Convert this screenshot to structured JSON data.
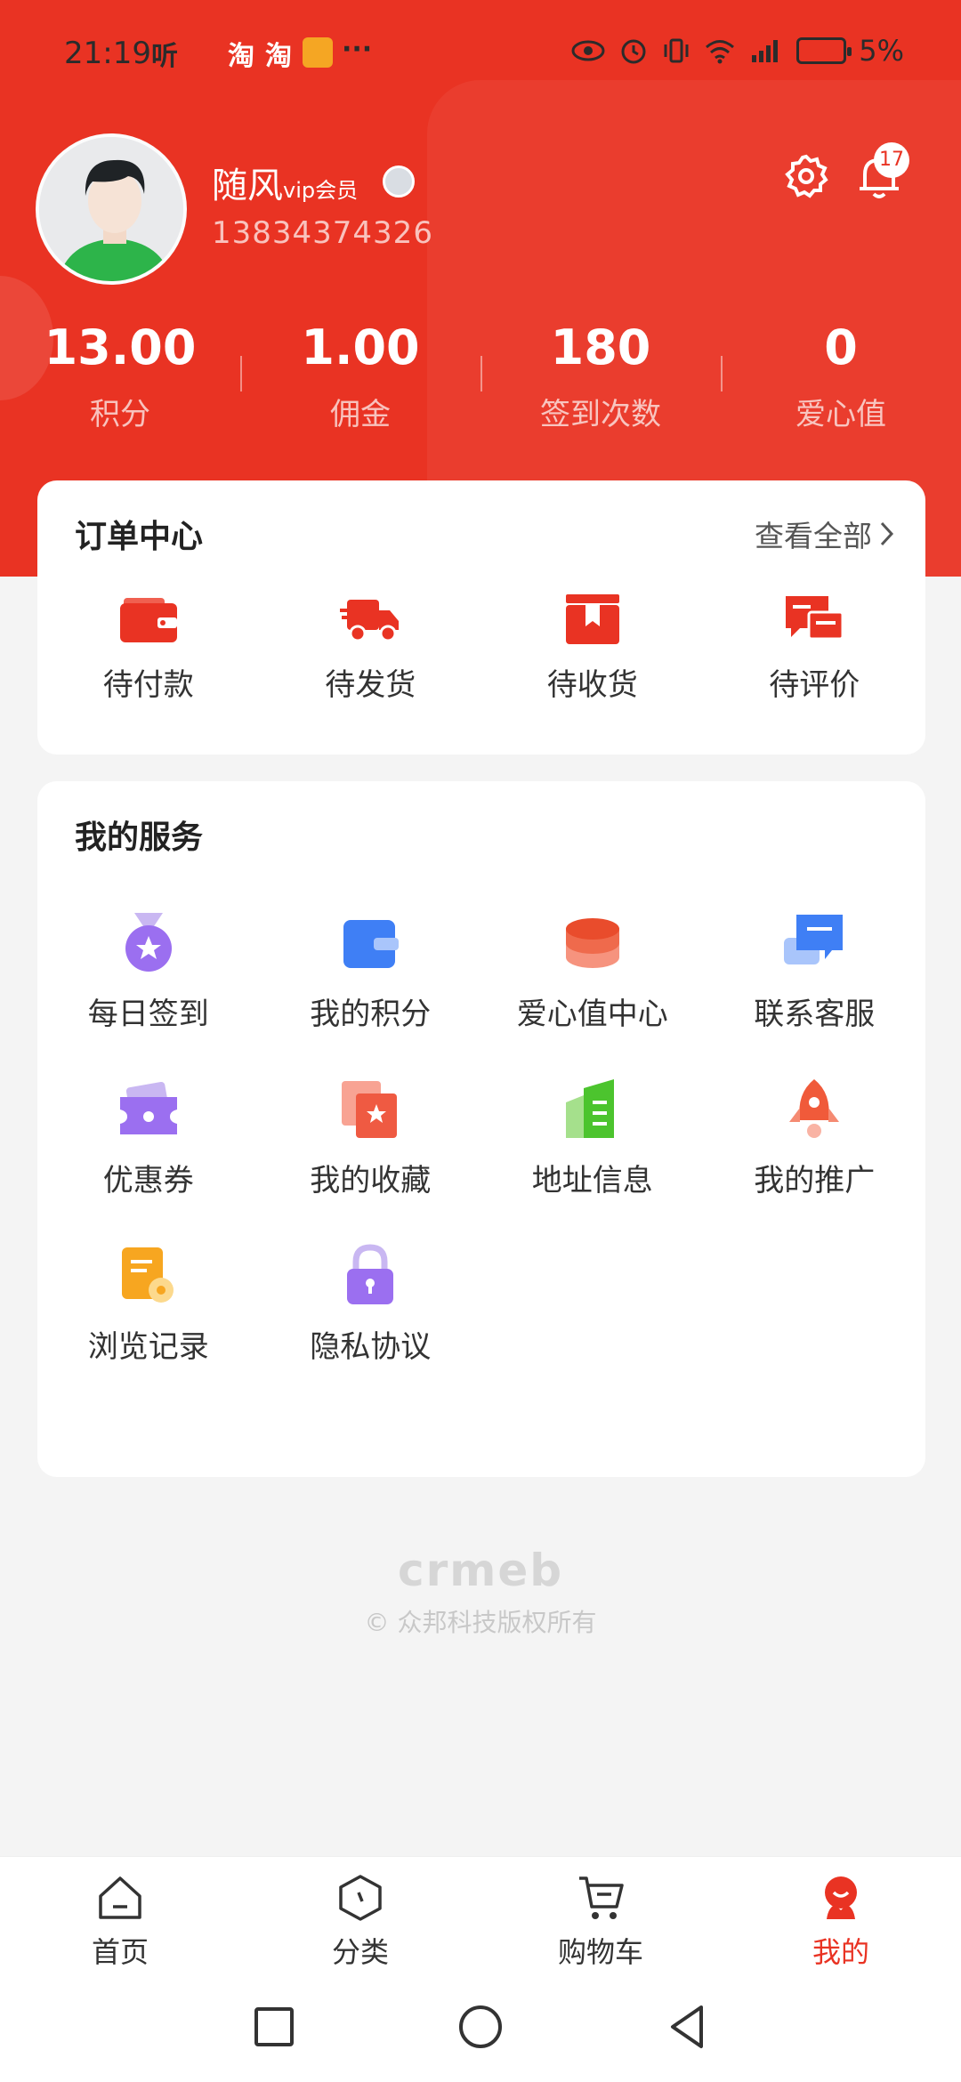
{
  "status_bar": {
    "time": "21:19",
    "app_icons": [
      "听",
      "淘",
      "淘"
    ],
    "more": "···",
    "battery": "5%"
  },
  "profile": {
    "name": "随风",
    "member_tag": "vip会员",
    "phone": "13834374326",
    "notification_count": "17"
  },
  "stats": [
    {
      "value": "13.00",
      "label": "积分"
    },
    {
      "value": "1.00",
      "label": "佣金"
    },
    {
      "value": "180",
      "label": "签到次数"
    },
    {
      "value": "0",
      "label": "爱心值"
    }
  ],
  "orders": {
    "title": "订单中心",
    "view_all": "查看全部",
    "items": [
      {
        "label": "待付款",
        "icon": "wallet-icon"
      },
      {
        "label": "待发货",
        "icon": "truck-icon"
      },
      {
        "label": "待收货",
        "icon": "package-icon"
      },
      {
        "label": "待评价",
        "icon": "review-icon"
      }
    ]
  },
  "services": {
    "title": "我的服务",
    "items": [
      {
        "label": "每日签到",
        "icon": "medal-icon"
      },
      {
        "label": "我的积分",
        "icon": "points-wallet-icon"
      },
      {
        "label": "爱心值中心",
        "icon": "coins-stack-icon"
      },
      {
        "label": "联系客服",
        "icon": "chat-icon"
      },
      {
        "label": "优惠券",
        "icon": "coupon-icon"
      },
      {
        "label": "我的收藏",
        "icon": "favorite-icon"
      },
      {
        "label": "地址信息",
        "icon": "building-icon"
      },
      {
        "label": "我的推广",
        "icon": "rocket-icon"
      },
      {
        "label": "浏览记录",
        "icon": "history-icon"
      },
      {
        "label": "隐私协议",
        "icon": "lock-icon"
      }
    ]
  },
  "footer": {
    "logo": "crmeb",
    "copyright": "© 众邦科技版权所有"
  },
  "tabbar": {
    "items": [
      {
        "label": "首页",
        "icon": "home-icon"
      },
      {
        "label": "分类",
        "icon": "category-icon"
      },
      {
        "label": "购物车",
        "icon": "cart-icon"
      },
      {
        "label": "我的",
        "icon": "profile-icon"
      }
    ],
    "active": "我的"
  },
  "colors": {
    "brand": "#e93323",
    "background": "#f4f4f4"
  }
}
